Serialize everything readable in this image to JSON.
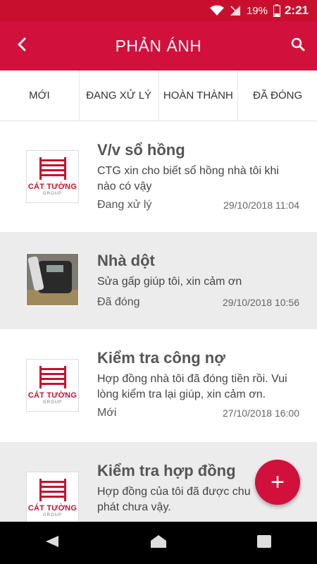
{
  "status_bar": {
    "battery": "19%",
    "time": "2:21"
  },
  "header": {
    "title": "PHẢN ÁNH"
  },
  "tabs": [
    {
      "label": "MỚI"
    },
    {
      "label": "ĐANG XỬ LÝ"
    },
    {
      "label": "HOÀN THÀNH"
    },
    {
      "label": "ĐÃ ĐÓNG"
    }
  ],
  "logo": {
    "name": "CÁT TƯỜNG",
    "sub": "GROUP"
  },
  "items": [
    {
      "title": "V/v sổ hồng",
      "desc": "CTG xin  cho biết sổ hồng nhà tôi khi nào có vậy",
      "status": "Đang xử lý",
      "time": "29/10/2018 11:04"
    },
    {
      "title": "Nhà dột",
      "desc": "Sửa gấp giúp tôi, xin cảm ơn",
      "status": "Đã đóng",
      "time": "29/10/2018 10:56"
    },
    {
      "title": "Kiểm tra công nợ",
      "desc": "Hợp đồng nhà tôi đã đóng tiền rồi. Vui lòng kiểm tra lại giúp, xin cảm ơn.",
      "status": "Mới",
      "time": "27/10/2018 16:00"
    },
    {
      "title": "Kiểm tra hợp đồng",
      "desc": "Hợp đồng của tôi đã được chu phát chưa vậy.",
      "status": "",
      "time": ""
    }
  ],
  "fab": {
    "label": "+"
  },
  "colors": {
    "primary": "#d1103b",
    "status_bar": "#c8102e",
    "alt_row": "#ececec"
  }
}
